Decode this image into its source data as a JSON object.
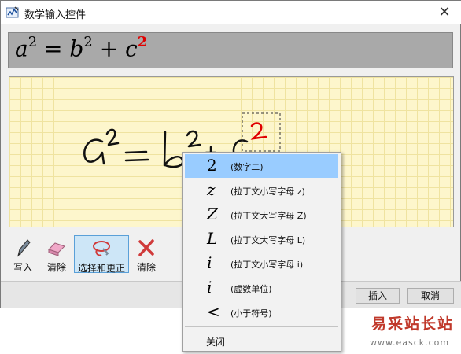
{
  "window": {
    "title": "数学输入控件",
    "close_glyph": "✕"
  },
  "preview": {
    "base_a": "a",
    "exp_a": "2",
    "equals": " = ",
    "base_b": "b",
    "exp_b": "2",
    "plus": " + ",
    "base_c": "c",
    "exp_c": "2",
    "highlight_color": "#e00000"
  },
  "toolbar": {
    "write_label": "写入",
    "erase_label": "清除",
    "select_correct_label": "选择和更正",
    "clear_label": "清除"
  },
  "buttons": {
    "insert_label": "插入",
    "cancel_label": "取消"
  },
  "menu": {
    "items": [
      {
        "symbol": "2",
        "desc": "(数字二)"
      },
      {
        "symbol": "z",
        "desc": "(拉丁文小写字母 z)"
      },
      {
        "symbol": "Z",
        "desc": "(拉丁文大写字母 Z)"
      },
      {
        "symbol": "L",
        "desc": "(拉丁文大写字母 L)"
      },
      {
        "symbol": "i",
        "desc": "(拉丁文小写字母 i)"
      },
      {
        "symbol": "i",
        "desc": "(虚数单位)"
      },
      {
        "symbol": "<",
        "desc": "(小于符号)"
      }
    ],
    "close_label": "关闭"
  },
  "watermark": {
    "title": "易采站长站",
    "url": "www.easck.com"
  },
  "colors": {
    "accent": "#99ccff",
    "canvas": "#fdf6cc",
    "selection_border": "#5aa0d8"
  }
}
